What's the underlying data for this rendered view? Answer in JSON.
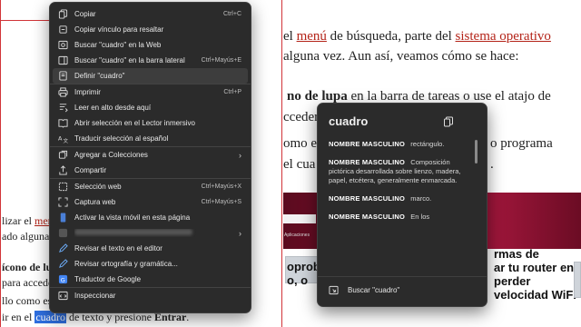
{
  "article": {
    "line1": {
      "pre": " el ",
      "w1": "menú",
      "mid": " de búsqueda, parte del ",
      "w2": "sistema operativo"
    },
    "line2": "alguna vez. Aun así, veamos cómo se hace:",
    "line3": {
      "bold": "no de lupa",
      "rest": " en la barra de tareas o use el atajo de"
    },
    "line4": "cceder",
    "line4b": "o programa",
    "line5": "omo es",
    "line6": "el cua",
    "line6b": ".",
    "left1": {
      "pre": "lizar el ",
      "u": "menú"
    },
    "left2": "ado alguna v",
    "left3": "ícono de lu",
    "left4": "para acceder a",
    "left5": "llo como esc",
    "left6": {
      "pre": "ir en el ",
      "sel": "cuadro",
      "post": " de texto y presione ",
      "bold": "Entrar",
      "end": "."
    },
    "card1": "oprobar",
    "card2": "o, o",
    "card3a": "rmas de",
    "card3b": "ar tu router en",
    "card3c": "perder",
    "card3d": "velocidad WiFi",
    "band_tab": "Aplicaciones"
  },
  "context_menu": {
    "items": [
      {
        "icon": "copy-icon",
        "label": "Copiar",
        "shortcut": "Ctrl+C"
      },
      {
        "icon": "link-copy-icon",
        "label": "Copiar vínculo para resaltar",
        "shortcut": ""
      },
      {
        "icon": "search-web-icon",
        "label": "Buscar \"cuadro\" en la Web",
        "shortcut": ""
      },
      {
        "icon": "sidebar-search-icon",
        "label": "Buscar \"cuadro\" en la barra lateral",
        "shortcut": "Ctrl+Mayús+E"
      },
      {
        "icon": "book-icon",
        "label": "Definir \"cuadro\"",
        "shortcut": ""
      },
      {
        "icon": "printer-icon",
        "label": "Imprimir",
        "shortcut": "Ctrl+P"
      },
      {
        "icon": "read-aloud-icon",
        "label": "Leer en alto desde aquí",
        "shortcut": ""
      },
      {
        "icon": "immersive-reader-icon",
        "label": "Abrir selección en el Lector inmersivo",
        "shortcut": ""
      },
      {
        "icon": "translate-icon",
        "label": "Traducir selección al español",
        "shortcut": ""
      },
      {
        "icon": "collections-icon",
        "label": "Agregar a Colecciones",
        "shortcut": ""
      },
      {
        "icon": "share-icon",
        "label": "Compartir",
        "shortcut": ""
      },
      {
        "icon": "web-select-icon",
        "label": "Selección web",
        "shortcut": "Ctrl+Mayús+X"
      },
      {
        "icon": "web-capture-icon",
        "label": "Captura web",
        "shortcut": "Ctrl+Mayús+S"
      },
      {
        "icon": "mobile-view-icon",
        "label": "Activar la vista móvil en esta página",
        "shortcut": ""
      },
      {
        "icon": "extension-icon",
        "label": "",
        "shortcut": ""
      },
      {
        "icon": "editor-icon",
        "label": "Revisar el texto en el editor",
        "shortcut": ""
      },
      {
        "icon": "spellcheck-icon",
        "label": "Revisar ortografía y gramática...",
        "shortcut": ""
      },
      {
        "icon": "google-translate-icon",
        "label": "Traductor de Google",
        "shortcut": ""
      },
      {
        "icon": "inspect-icon",
        "label": "Inspeccionar",
        "shortcut": ""
      }
    ]
  },
  "dictionary": {
    "word": "cuadro",
    "definitions": [
      {
        "pos": "NOMBRE MASCULINO",
        "text": "rectángulo."
      },
      {
        "pos": "NOMBRE MASCULINO",
        "text": "Composición pictórica desarrollada sobre lienzo, madera, papel, etcétera, generalmente enmarcada."
      },
      {
        "pos": "NOMBRE MASCULINO",
        "text": "marco."
      },
      {
        "pos": "NOMBRE MASCULINO",
        "text": "En los"
      }
    ],
    "search_label": "Buscar \"cuadro\""
  },
  "colors": {
    "accent_red": "#d13438",
    "menu_bg": "#2b2b2b",
    "selection": "#2f6fe0"
  }
}
